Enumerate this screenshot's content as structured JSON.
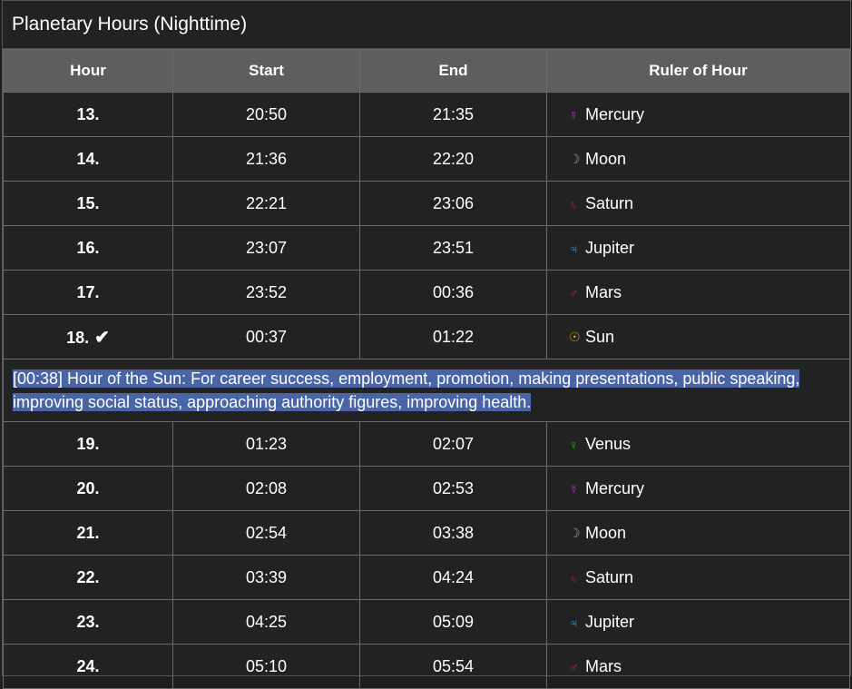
{
  "title": "Planetary Hours (Nighttime)",
  "headers": {
    "hour": "Hour",
    "start": "Start",
    "end": "End",
    "ruler": "Ruler of Hour"
  },
  "rows_before": [
    {
      "hour": "13.",
      "start": "20:50",
      "end": "21:35",
      "ruler": "Mercury",
      "symbol": "☿",
      "color": "#d02ad0"
    },
    {
      "hour": "14.",
      "start": "21:36",
      "end": "22:20",
      "ruler": "Moon",
      "symbol": "☽",
      "color": "#9a9a9a"
    },
    {
      "hour": "15.",
      "start": "22:21",
      "end": "23:06",
      "ruler": "Saturn",
      "symbol": "♄",
      "color": "#b0201e"
    },
    {
      "hour": "16.",
      "start": "23:07",
      "end": "23:51",
      "ruler": "Jupiter",
      "symbol": "♃",
      "color": "#3a9bc8"
    },
    {
      "hour": "17.",
      "start": "23:52",
      "end": "00:36",
      "ruler": "Mars",
      "symbol": "♂",
      "color": "#e02020"
    },
    {
      "hour": "18.",
      "start": "00:37",
      "end": "01:22",
      "ruler": "Sun",
      "symbol": "☉",
      "color": "#e8a21a",
      "current": true
    }
  ],
  "current_marker": "✔",
  "info_text": "[00:38] Hour of the Sun: For career success, employment, promotion, making presentations, public speaking, improving social status, approaching authority figures, improving health.",
  "rows_after": [
    {
      "hour": "19.",
      "start": "01:23",
      "end": "02:07",
      "ruler": "Venus",
      "symbol": "♀",
      "color": "#22b022"
    },
    {
      "hour": "20.",
      "start": "02:08",
      "end": "02:53",
      "ruler": "Mercury",
      "symbol": "☿",
      "color": "#d02ad0"
    },
    {
      "hour": "21.",
      "start": "02:54",
      "end": "03:38",
      "ruler": "Moon",
      "symbol": "☽",
      "color": "#9a9a9a"
    },
    {
      "hour": "22.",
      "start": "03:39",
      "end": "04:24",
      "ruler": "Saturn",
      "symbol": "♄",
      "color": "#b0201e"
    },
    {
      "hour": "23.",
      "start": "04:25",
      "end": "05:09",
      "ruler": "Jupiter",
      "symbol": "♃",
      "color": "#3a9bc8"
    },
    {
      "hour": "24.",
      "start": "05:10",
      "end": "05:54",
      "ruler": "Mars",
      "symbol": "♂",
      "color": "#e02020"
    }
  ]
}
